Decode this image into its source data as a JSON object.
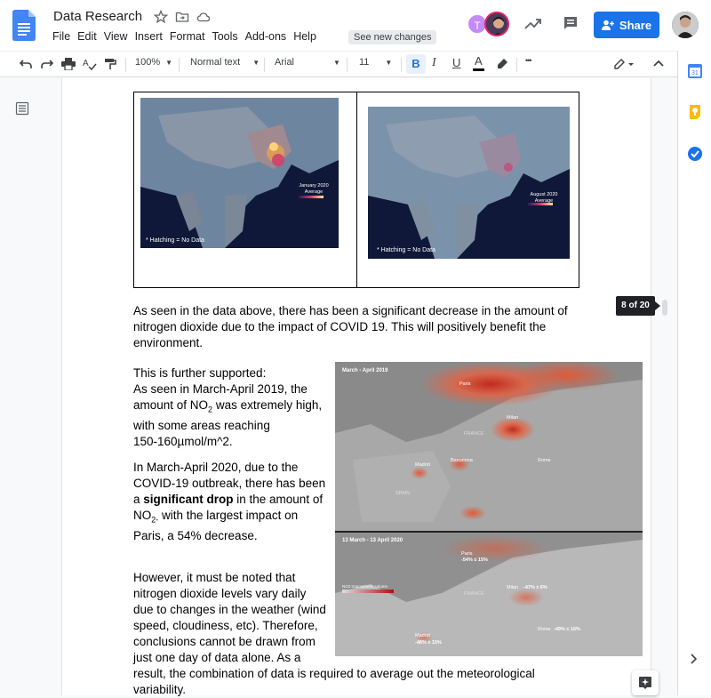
{
  "app": {
    "title": "Data Research",
    "menu": [
      "File",
      "Edit",
      "View",
      "Insert",
      "Format",
      "Tools",
      "Add-ons",
      "Help"
    ],
    "see_changes": "See new changes",
    "share_label": "Share",
    "avatar_letter": "T",
    "accent": "#1a73e8"
  },
  "toolbar": {
    "zoom": "100%",
    "style": "Normal text",
    "font": "Arial",
    "size": "11",
    "bold": "B",
    "italic": "I",
    "underline": "U",
    "text_color": "A",
    "more": "•••"
  },
  "page_badge": "8 of 20",
  "maps": {
    "left_note": "* Hatching = No Data",
    "left_legend_title": "January 2020 Average",
    "right_note": "* Hatching = No Data",
    "right_legend_title": "August 2020 Average"
  },
  "paragraph1": "As seen in the data above, there has been a significant decrease in the amount of nitrogen dioxide due to the impact of COVID 19. This will positively benefit the environment.",
  "para2": {
    "line1": "This is further supported:",
    "line2": "As seen in March-April 2019, the",
    "line3_pre": "amount of NO",
    "line3_sub": "2",
    "line3_post": " was extremely high,",
    "line4": "with some areas reaching",
    "line5": "150-160µmol/m^2."
  },
  "para3": {
    "line1": "In March-April 2020, due to the",
    "line2": "COVID-19 outbreak, there has been",
    "line3_pre": "a ",
    "line3_bold": "significant drop",
    "line3_post": " in the amount of",
    "line4_pre": "NO",
    "line4_sub": "2-",
    "line4_post": " with the largest impact on",
    "line5": "Paris, a 54% decrease."
  },
  "para4": {
    "line1": "However, it must be noted that",
    "line2": "nitrogen dioxide levels vary daily",
    "line3": "due to changes in the weather (wind",
    "line4": "speed, cloudiness, etc). Therefore,",
    "line5": "conclusions cannot be drawn from",
    "line6": "just one day of data alone. As a",
    "line7": "result, the combination of data is required to average out the meteorological",
    "line8": "variability."
  },
  "europe_map": {
    "top_label": "March - April 2019",
    "bottom_label": "13 March - 13 April 2020",
    "paris": "Paris",
    "paris_change": "-54% ± 15%",
    "milan": "Milan",
    "milan_change": "-47% ± 6%",
    "madrid": "Madrid",
    "madrid_change": "-48% ± 15%",
    "rome": "Rome",
    "rome_change": "-49% ± 16%",
    "barcelona": "Barcelona",
    "france": "FRANCE",
    "spain": "SPAIN",
    "legend": "NO2 tropospheric column"
  }
}
